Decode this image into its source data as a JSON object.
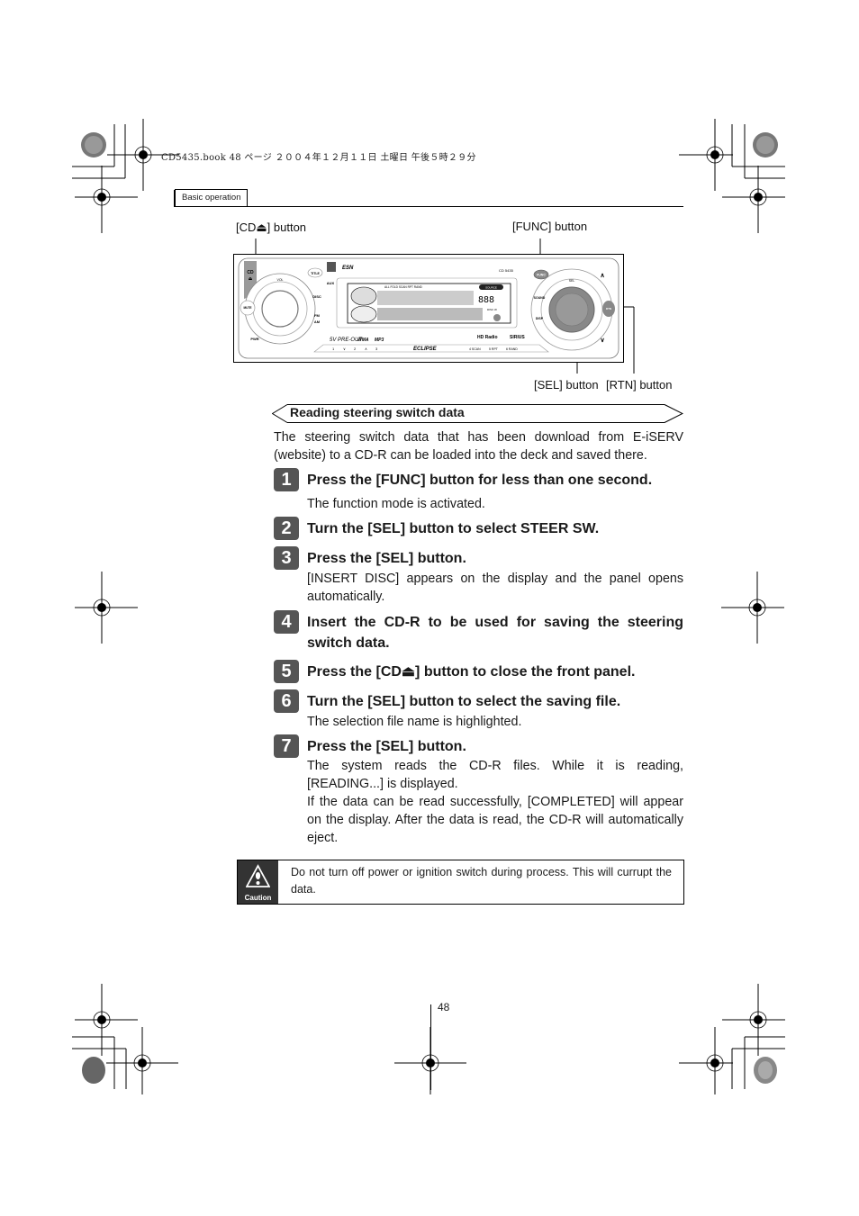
{
  "print_header": "CD5435.book  48 ページ  ２００４年１２月１１日  土曜日  午後５時２９分",
  "section_tab": "Basic operation",
  "figure": {
    "callouts": {
      "cd_eject": "[CD⏏] button",
      "func": "[FUNC] button",
      "sel": "[SEL] button",
      "rtn": "[RTN] button"
    },
    "device": {
      "brand": "ECLIPSE",
      "model": "CD 5435",
      "esn_logo": "ESN",
      "buttons": {
        "cd": "CD",
        "vol": "VOL",
        "mute": "MUTE",
        "pwr": "PWR",
        "title": "TITLE",
        "aux": "AUX",
        "disc": "DISC",
        "fm": "FM",
        "am": "AM",
        "func": "FUNC",
        "sel": "SEL",
        "sound": "SOUND",
        "disp": "DISP",
        "rtn": "RTN",
        "up": "∧",
        "down": "∨"
      },
      "display_indicators": "ALL FOLD SCAN RPT RAND",
      "source_label": "SOURCE",
      "disc_w": "DISC W",
      "badges": {
        "preout": "5V PRE-OUT",
        "wma": "WMA",
        "mp3": "MP3",
        "hd_radio": "HD Radio",
        "sirius": "SIRIUS"
      },
      "presets": [
        "1",
        "∨",
        "2",
        "∧",
        "3",
        "4 SCAN",
        "5 RPT",
        "6 RAND"
      ]
    }
  },
  "section": {
    "heading": "Reading steering switch data",
    "intro": "The steering switch data that has been download from E-iSERV (website) to a CD-R can be loaded into the deck and saved there."
  },
  "steps": [
    {
      "num": "1",
      "title": "Press the [FUNC] button for less than one second.",
      "desc": "The function mode is activated."
    },
    {
      "num": "2",
      "title": "Turn the [SEL] button to select STEER SW.",
      "desc": ""
    },
    {
      "num": "3",
      "title": "Press the [SEL] button.",
      "desc": "[INSERT DISC] appears on the display and the panel opens automatically."
    },
    {
      "num": "4",
      "title": "Insert the CD-R to be used for saving the steering switch data.",
      "desc": ""
    },
    {
      "num": "5",
      "title": "Press the [CD⏏] button to close the front panel.",
      "desc": ""
    },
    {
      "num": "6",
      "title": "Turn the [SEL] button to select the saving file.",
      "desc": "The selection file name is highlighted."
    },
    {
      "num": "7",
      "title": "Press the [SEL] button.",
      "desc": "The system reads the CD-R files. While it is reading, [READING...] is displayed.",
      "desc2": "If the data can be read successfully, [COMPLETED] will appear on the display. After the data is read, the CD-R will automatically eject."
    }
  ],
  "caution": {
    "label": "Caution",
    "icon": "warning-triangle-icon",
    "text": "Do not turn off power or ignition switch during process. This will currupt the data."
  },
  "page_number": "48"
}
